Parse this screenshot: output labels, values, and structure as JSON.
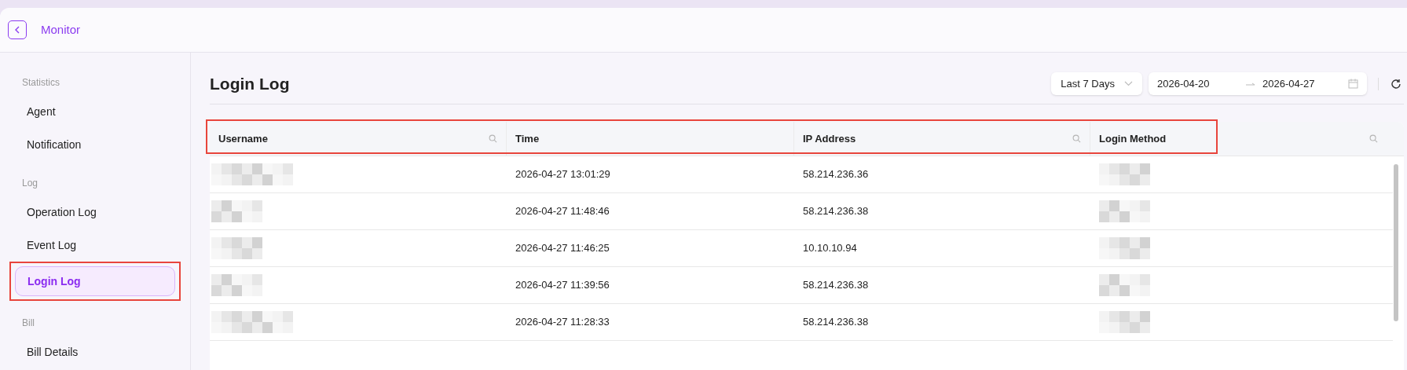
{
  "header": {
    "title": "Monitor"
  },
  "sidebar": {
    "groups": [
      {
        "label": "Statistics",
        "items": [
          {
            "label": "Agent",
            "selected": false,
            "highlighted": false
          },
          {
            "label": "Notification",
            "selected": false,
            "highlighted": false
          }
        ]
      },
      {
        "label": "Log",
        "items": [
          {
            "label": "Operation Log",
            "selected": false,
            "highlighted": false
          },
          {
            "label": "Event Log",
            "selected": false,
            "highlighted": false
          },
          {
            "label": "Login Log",
            "selected": true,
            "highlighted": true
          }
        ]
      },
      {
        "label": "Bill",
        "items": [
          {
            "label": "Bill Details",
            "selected": false,
            "highlighted": false
          }
        ]
      }
    ]
  },
  "page": {
    "title": "Login Log",
    "range_select": {
      "value": "Last 7 Days"
    },
    "date_range": {
      "start": "2026-04-20",
      "end": "2026-04-27"
    }
  },
  "table": {
    "header_highlighted": true,
    "columns": [
      {
        "label": "Username",
        "searchable": true
      },
      {
        "label": "Time",
        "searchable": false
      },
      {
        "label": "IP Address",
        "searchable": true
      },
      {
        "label": "Login Method",
        "searchable": true
      }
    ],
    "rows": [
      {
        "username": {
          "kind": "redacted"
        },
        "time": "2026-04-27 13:01:29",
        "ip": "58.214.236.36",
        "method": {
          "kind": "redacted"
        }
      },
      {
        "username": {
          "kind": "redacted"
        },
        "time": "2026-04-27 11:48:46",
        "ip": "58.214.236.38",
        "method": {
          "kind": "redacted"
        }
      },
      {
        "username": {
          "kind": "redacted"
        },
        "time": "2026-04-27 11:46:25",
        "ip": "10.10.10.94",
        "method": {
          "kind": "redacted"
        }
      },
      {
        "username": {
          "kind": "redacted"
        },
        "time": "2026-04-27 11:39:56",
        "ip": "58.214.236.38",
        "method": {
          "kind": "redacted"
        }
      },
      {
        "username": {
          "kind": "redacted"
        },
        "time": "2026-04-27 11:28:33",
        "ip": "58.214.236.38",
        "method": {
          "kind": "redacted"
        }
      }
    ]
  }
}
